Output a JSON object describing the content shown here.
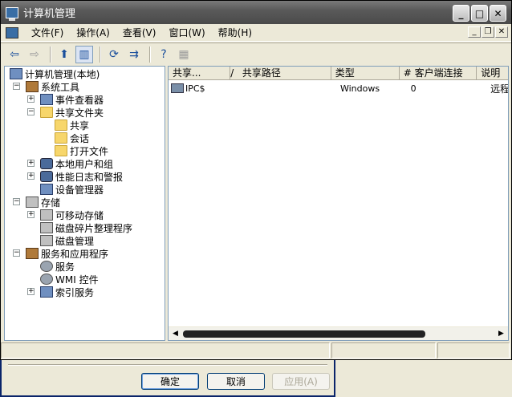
{
  "window": {
    "title": "计算机管理"
  },
  "menu": [
    "文件(F)",
    "操作(A)",
    "查看(V)",
    "窗口(W)",
    "帮助(H)"
  ],
  "tree": [
    {
      "label": "计算机管理(本地)",
      "level": 0,
      "expand": "",
      "icon": "computer"
    },
    {
      "label": "系统工具",
      "level": 1,
      "expand": "-",
      "icon": "tools"
    },
    {
      "label": "事件查看器",
      "level": 2,
      "expand": "+",
      "icon": "event"
    },
    {
      "label": "共享文件夹",
      "level": 2,
      "expand": "-",
      "icon": "folder"
    },
    {
      "label": "共享",
      "level": 3,
      "expand": "",
      "icon": "folder"
    },
    {
      "label": "会话",
      "level": 3,
      "expand": "",
      "icon": "folder"
    },
    {
      "label": "打开文件",
      "level": 3,
      "expand": "",
      "icon": "folder"
    },
    {
      "label": "本地用户和组",
      "level": 2,
      "expand": "+",
      "icon": "users"
    },
    {
      "label": "性能日志和警报",
      "level": 2,
      "expand": "+",
      "icon": "perf"
    },
    {
      "label": "设备管理器",
      "level": 2,
      "expand": "",
      "icon": "device"
    },
    {
      "label": "存储",
      "level": 1,
      "expand": "-",
      "icon": "storage"
    },
    {
      "label": "可移动存储",
      "level": 2,
      "expand": "+",
      "icon": "removable"
    },
    {
      "label": "磁盘碎片整理程序",
      "level": 2,
      "expand": "",
      "icon": "defrag"
    },
    {
      "label": "磁盘管理",
      "level": 2,
      "expand": "",
      "icon": "disk"
    },
    {
      "label": "服务和应用程序",
      "level": 1,
      "expand": "-",
      "icon": "services-apps"
    },
    {
      "label": "服务",
      "level": 2,
      "expand": "",
      "icon": "gear"
    },
    {
      "label": "WMI 控件",
      "level": 2,
      "expand": "",
      "icon": "wmi"
    },
    {
      "label": "索引服务",
      "level": 2,
      "expand": "+",
      "icon": "index"
    }
  ],
  "list": {
    "columns": [
      "共享...",
      "/",
      "共享路径",
      "类型",
      "# 客户端连接",
      "说明"
    ],
    "rows": [
      {
        "name": "IPC$",
        "path": "",
        "type": "Windows",
        "clients": "0",
        "desc": "远程"
      }
    ]
  },
  "dialog": {
    "ok": "确定",
    "cancel": "取消",
    "apply": "应用(A)"
  }
}
